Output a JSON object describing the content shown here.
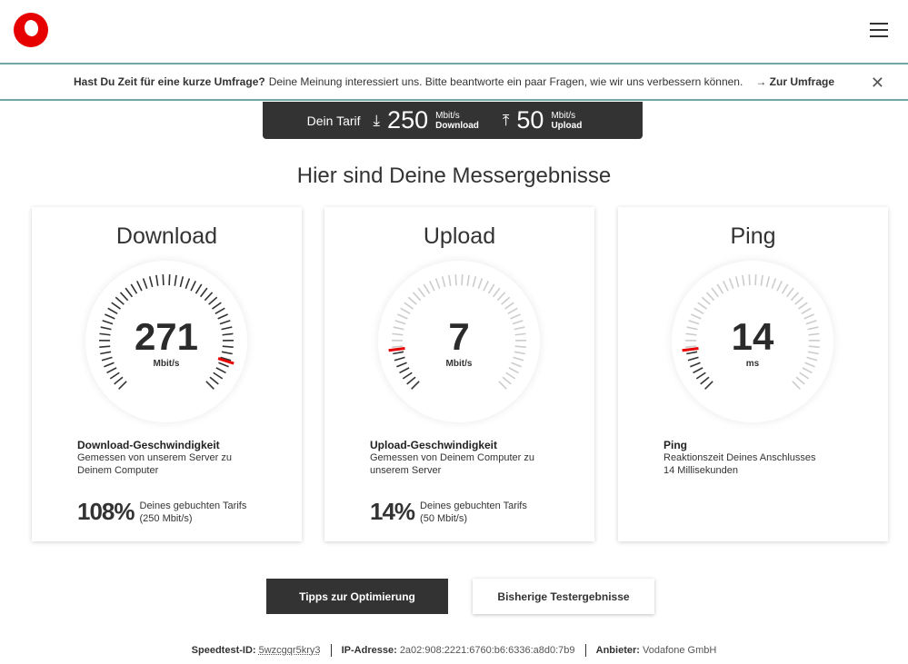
{
  "header": {
    "logo": "Vodafone",
    "menu_icon": "hamburger-icon"
  },
  "survey": {
    "question": "Hast Du Zeit für eine kurze Umfrage?",
    "text": "Deine Meinung interessiert uns. Bitte beantworte ein paar Fragen, wie wir uns verbessern können.",
    "link": "→ Zur Umfrage",
    "close": "✕"
  },
  "tarif": {
    "label": "Dein Tarif",
    "download_value": "250",
    "download_unit": "Mbit/s",
    "download_label": "Download",
    "upload_value": "50",
    "upload_unit": "Mbit/s",
    "upload_label": "Upload"
  },
  "title": "Hier sind Deine Messergebnisse",
  "cards": [
    {
      "title": "Download",
      "value": "271",
      "unit": "Mbit/s",
      "desc_title": "Download-Geschwindigkeit",
      "desc": "Gemessen von unserem Server zu Deinem Computer",
      "percent": "108%",
      "percent_text": "Deines gebuchten Tarifs",
      "percent_sub": "(250 Mbit/s)",
      "gauge_fill": 1.0,
      "gauge_marker": 0.9
    },
    {
      "title": "Upload",
      "value": "7",
      "unit": "Mbit/s",
      "desc_title": "Upload-Geschwindigkeit",
      "desc": "Gemessen von Deinem Computer zu unserem Server",
      "percent": "14%",
      "percent_text": "Deines gebuchten Tarifs",
      "percent_sub": "(50 Mbit/s)",
      "gauge_fill": 0.14,
      "gauge_marker": 0.14
    },
    {
      "title": "Ping",
      "value": "14",
      "unit": "ms",
      "desc_title": "Ping",
      "desc": "Reaktionszeit Deines Anschlusses 14 Millisekunden",
      "gauge_fill": 0.14,
      "gauge_marker": 0.14
    }
  ],
  "colors": {
    "accent": "#e60000",
    "dark": "#333333",
    "light_tick": "#cccccc",
    "border": "#6fa7a9"
  },
  "buttons": {
    "primary": "Tipps zur Optimierung",
    "secondary": "Bisherige Testergebnisse"
  },
  "footer": {
    "id_label": "Speedtest-ID:",
    "id": "5wzcgqr5kry3",
    "ip_label": "IP-Adresse:",
    "ip": "2a02:908:2221:6760:b6:6336:a8d0:7b9",
    "provider_label": "Anbieter:",
    "provider": "Vodafone GmbH"
  }
}
